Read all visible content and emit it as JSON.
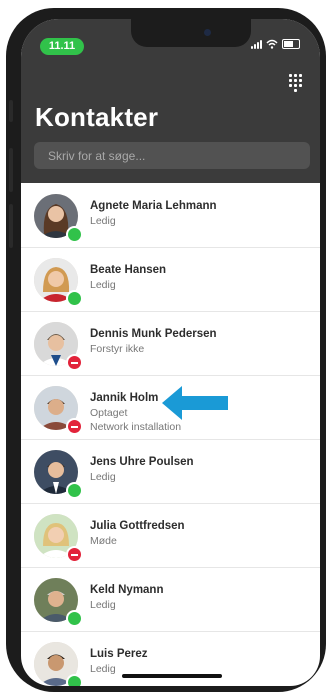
{
  "status_bar": {
    "time": "11.11",
    "time_color": "#31c24a"
  },
  "header": {
    "title": "Kontakter",
    "search_placeholder": "Skriv for at søge..."
  },
  "colors": {
    "header_bg": "#3b3b3b",
    "available": "#31c24a",
    "busy": "#e2233a",
    "arrow": "#1a9ad6"
  },
  "contacts": [
    {
      "name": "Agnete Maria Lehmann",
      "status": "Ledig",
      "presence": "available",
      "icon": "avatar-photo"
    },
    {
      "name": "Beate Hansen",
      "status": "Ledig",
      "presence": "available",
      "icon": "avatar-photo"
    },
    {
      "name": "Dennis Munk Pedersen",
      "status": "Forstyr ikke",
      "presence": "busy",
      "icon": "avatar-photo"
    },
    {
      "name": "Jannik Holm",
      "status": "Optaget",
      "note": "Network installation",
      "presence": "busy",
      "icon": "avatar-photo"
    },
    {
      "name": "Jens Uhre Poulsen",
      "status": "Ledig",
      "presence": "available",
      "icon": "avatar-photo"
    },
    {
      "name": "Julia Gottfredsen",
      "status": "Møde",
      "presence": "busy",
      "icon": "avatar-photo"
    },
    {
      "name": "Keld Nymann",
      "status": "Ledig",
      "presence": "available",
      "icon": "avatar-photo"
    },
    {
      "name": "Luis Perez",
      "status": "Ledig",
      "presence": "available",
      "icon": "avatar-photo"
    }
  ]
}
